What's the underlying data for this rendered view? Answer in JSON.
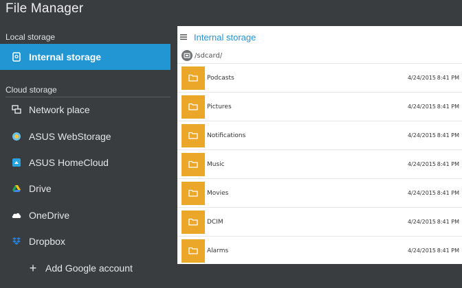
{
  "app": {
    "title": "File Manager"
  },
  "sidebar": {
    "local_header": "Local storage",
    "cloud_header": "Cloud storage",
    "local_items": [
      {
        "label": "Internal storage",
        "icon": "phone-storage-icon"
      }
    ],
    "cloud_items": [
      {
        "label": "Network place",
        "icon": "network-place-icon"
      },
      {
        "label": "ASUS WebStorage",
        "icon": "asus-webstorage-icon"
      },
      {
        "label": "ASUS HomeCloud",
        "icon": "asus-homecloud-icon"
      },
      {
        "label": "Drive",
        "icon": "google-drive-icon"
      },
      {
        "label": "OneDrive",
        "icon": "onedrive-icon"
      },
      {
        "label": "Dropbox",
        "icon": "dropbox-icon"
      }
    ],
    "add_account": "Add Google account"
  },
  "panel": {
    "title": "Internal storage",
    "path": "/sdcard/",
    "folders": [
      {
        "name": "Podcasts",
        "date": "4/24/2015",
        "time": "8:41 PM"
      },
      {
        "name": "Pictures",
        "date": "4/24/2015",
        "time": "8:41 PM"
      },
      {
        "name": "Notifications",
        "date": "4/24/2015",
        "time": "8:41 PM"
      },
      {
        "name": "Music",
        "date": "4/24/2015",
        "time": "8:41 PM"
      },
      {
        "name": "Movies",
        "date": "4/24/2015",
        "time": "8:41 PM"
      },
      {
        "name": "DCIM",
        "date": "4/24/2015",
        "time": "8:41 PM"
      },
      {
        "name": "Alarms",
        "date": "4/24/2015",
        "time": "8:41 PM"
      }
    ]
  },
  "colors": {
    "accent": "#2196d3",
    "background": "#3a3d3f",
    "folder": "#eaa72a"
  }
}
